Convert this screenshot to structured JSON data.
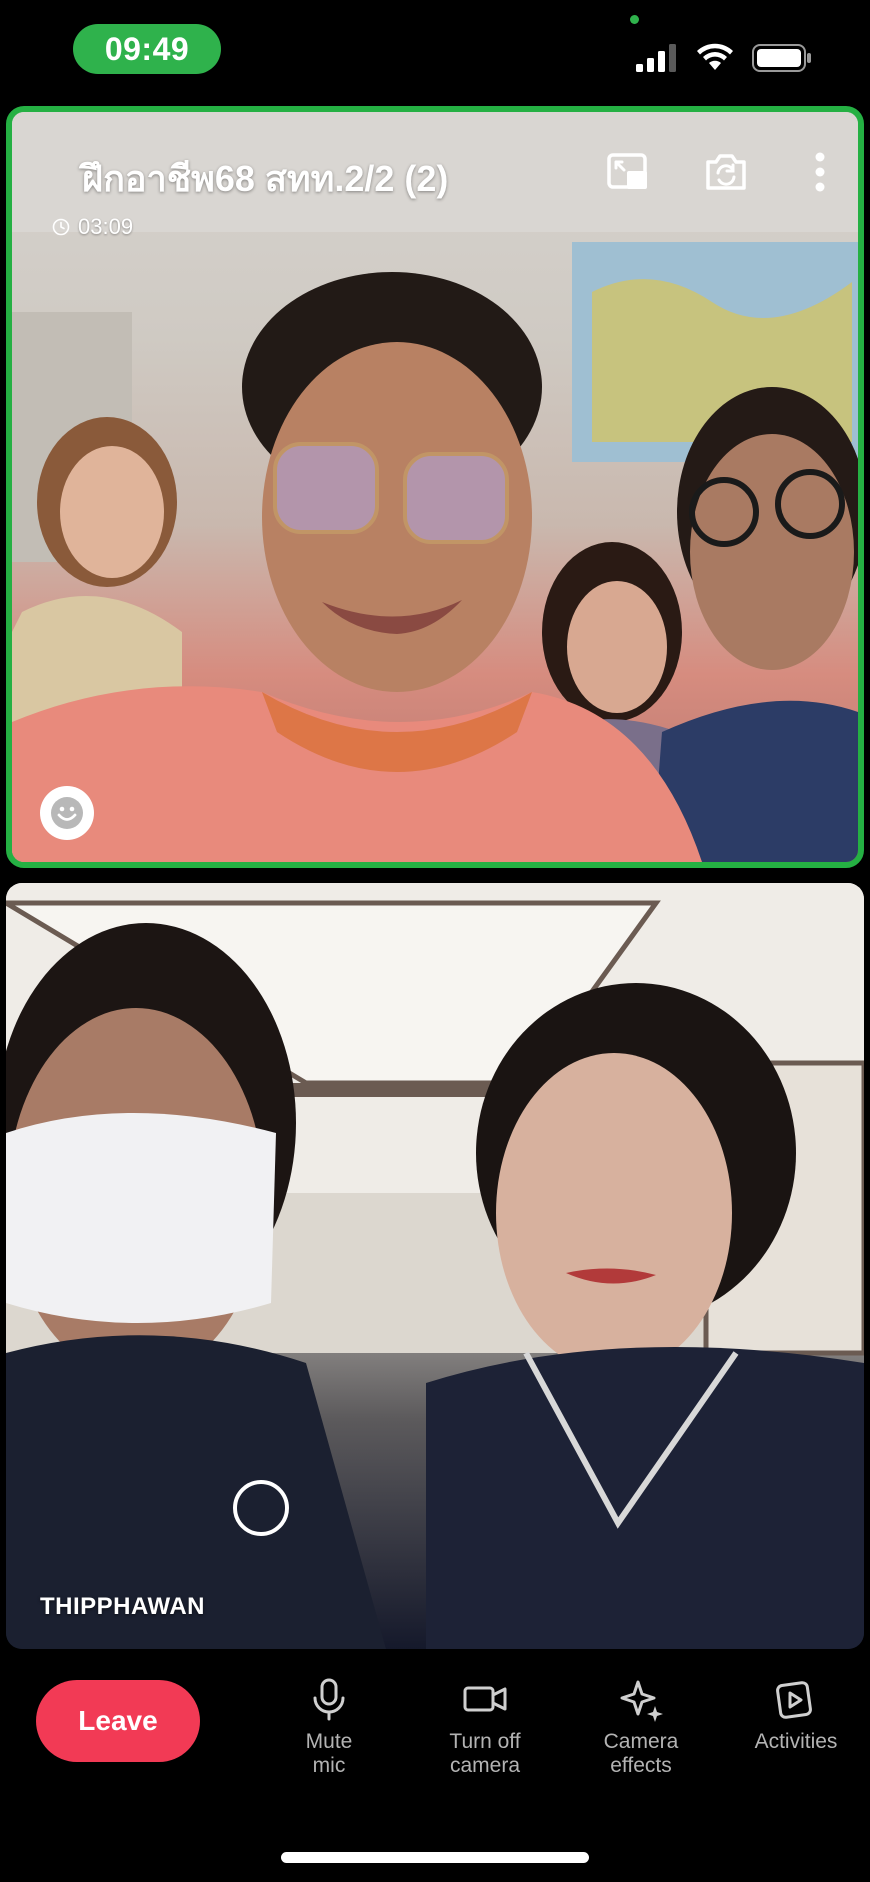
{
  "status_bar": {
    "time": "09:49"
  },
  "call": {
    "title": "ฝึกอาชีพ68 สทท.2/2  (2)",
    "timer": "03:09"
  },
  "bottom_tile": {
    "participant_name": "THIPPHAWAN"
  },
  "controls": {
    "leave": "Leave",
    "mute_line1": "Mute",
    "mute_line2": "mic",
    "camera_line1": "Turn off",
    "camera_line2": "camera",
    "effects_line1": "Camera",
    "effects_line2": "effects",
    "activities": "Activities"
  },
  "colors": {
    "accent_green": "#25b043",
    "leave_red": "#f23a55",
    "time_pill": "#2fb24c"
  },
  "icons": [
    "signal-icon",
    "wifi-icon",
    "battery-icon",
    "clock-icon",
    "pip-icon",
    "switch-camera-icon",
    "more-icon",
    "smiley-icon",
    "mic-icon",
    "video-camera-icon",
    "sparkle-icon",
    "activities-icon"
  ]
}
